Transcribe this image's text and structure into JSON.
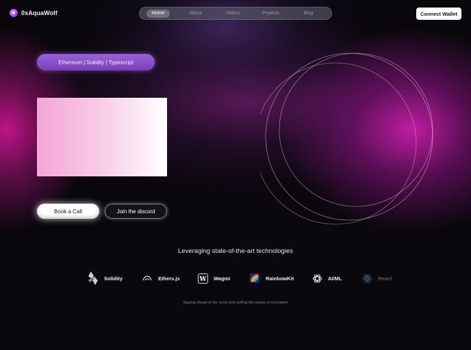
{
  "brand": {
    "name": "0xAquaWolf",
    "logo_icon": "wolf-icon"
  },
  "nav": {
    "items": [
      {
        "label": "Home",
        "active": true
      },
      {
        "label": "About",
        "active": false
      },
      {
        "label": "Videos",
        "active": false
      },
      {
        "label": "Projects",
        "active": false
      },
      {
        "label": "Blog",
        "active": false
      }
    ]
  },
  "header": {
    "connect_wallet_label": "Connect Wallet"
  },
  "hero": {
    "tech_pill": "Ethereum | Solidity | Typescript",
    "book_call_label": "Book a Call",
    "discord_label": "Join the discord"
  },
  "tech_section": {
    "title": "Leveraging state-of-the-art technologies",
    "items": [
      {
        "label": "Solidity",
        "icon": "solidity-icon"
      },
      {
        "label": "Ethers.js",
        "icon": "ethers-icon"
      },
      {
        "label": "Wagmi",
        "icon": "wagmi-icon"
      },
      {
        "label": "RainbowKit",
        "icon": "rainbowkit-icon"
      },
      {
        "label": "AI/ML",
        "icon": "openai-icon"
      },
      {
        "label": "React",
        "icon": "react-icon"
      }
    ],
    "tagline": "Staying ahead of the curve and surfing the waves of innovation"
  },
  "colors": {
    "accent_purple": "#8a4fd0",
    "magenta_glow": "#c81e8c",
    "background": "#0a080d"
  }
}
